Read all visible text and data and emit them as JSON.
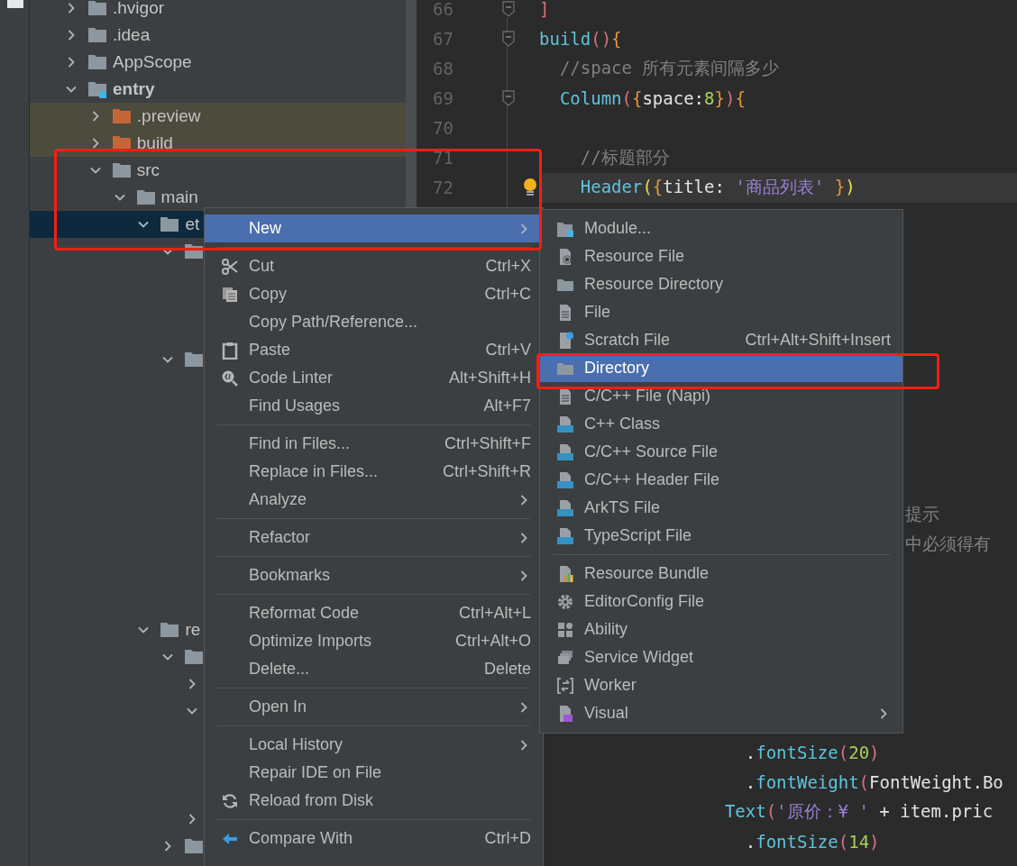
{
  "tree": [
    {
      "label": ".hvigor",
      "kind": "folder",
      "expanded": false,
      "selected": false,
      "excluded": false
    },
    {
      "label": ".idea",
      "kind": "folder",
      "expanded": false,
      "selected": false,
      "excluded": false
    },
    {
      "label": "AppScope",
      "kind": "folder",
      "expanded": false,
      "selected": false,
      "excluded": false
    },
    {
      "label": "entry",
      "kind": "module",
      "expanded": true,
      "selected": false,
      "excluded": false,
      "children": [
        {
          "label": ".preview",
          "kind": "folder",
          "expanded": false,
          "selected": false,
          "excluded": true
        },
        {
          "label": "build",
          "kind": "folder",
          "expanded": false,
          "selected": false,
          "excluded": true
        },
        {
          "label": "src",
          "kind": "folder",
          "expanded": true,
          "selected": false,
          "excluded": false,
          "children": [
            {
              "label": "main",
              "kind": "folder",
              "expanded": true,
              "selected": false,
              "excluded": false,
              "children": [
                {
                  "label": "et",
                  "kind": "folder",
                  "expanded": true,
                  "selected": true,
                  "excluded": false,
                  "children": [
                    {
                      "kind": "folder",
                      "expanded": true,
                      "selected": false,
                      "excluded": false
                    },
                    {
                      "kind": "folder",
                      "expanded": true,
                      "selected": false,
                      "excluded": false
                    }
                  ]
                },
                {
                  "label": "re",
                  "kind": "folder",
                  "expanded": true,
                  "selected": false,
                  "excluded": false,
                  "children": [
                    {
                      "kind": "folder",
                      "expanded": true,
                      "selected": false,
                      "excluded": false,
                      "children": [
                        {
                          "expanded": false,
                          "selected": false,
                          "excluded": false
                        },
                        {
                          "expanded": true,
                          "selected": false,
                          "excluded": false
                        },
                        {
                          "expanded": false,
                          "selected": false,
                          "excluded": false
                        }
                      ]
                    },
                    {
                      "kind": "folder",
                      "expanded": false,
                      "selected": false,
                      "excluded": false
                    }
                  ]
                }
              ]
            }
          ]
        }
      ]
    }
  ],
  "editor": {
    "lines": [
      {
        "number": "66",
        "fold": true,
        "current": false,
        "bulb": false,
        "tokens": [
          {
            "text": "]",
            "kind": "paren"
          }
        ]
      },
      {
        "number": "67",
        "fold": true,
        "current": false,
        "bulb": false,
        "tokens": [
          {
            "text": "build",
            "kind": "func"
          },
          {
            "text": "()",
            "kind": "paren"
          },
          {
            "text": "{",
            "kind": "brace"
          }
        ]
      },
      {
        "number": "68",
        "fold": false,
        "current": false,
        "bulb": false,
        "tokens": [
          {
            "text": "//space 所有元素间隔多少",
            "kind": "comment"
          }
        ]
      },
      {
        "number": "69",
        "fold": true,
        "current": false,
        "bulb": false,
        "tokens": [
          {
            "text": "Column",
            "kind": "func"
          },
          {
            "text": "(",
            "kind": "paren"
          },
          {
            "text": "{",
            "kind": "brace"
          },
          {
            "text": "space:",
            "kind": "plain"
          },
          {
            "text": "8",
            "kind": "number"
          },
          {
            "text": "}",
            "kind": "brace"
          },
          {
            "text": ")",
            "kind": "paren"
          },
          {
            "text": "{",
            "kind": "brace"
          }
        ]
      },
      {
        "number": "70",
        "fold": false,
        "current": false,
        "bulb": false
      },
      {
        "number": "71",
        "fold": false,
        "current": false,
        "bulb": false,
        "tokens": [
          {
            "text": "//标题部分",
            "kind": "comment"
          }
        ]
      },
      {
        "number": "72",
        "fold": false,
        "current": true,
        "bulb": true,
        "tokens": [
          {
            "text": "Header",
            "kind": "func"
          },
          {
            "text": "(",
            "kind": "match"
          },
          {
            "text": "{",
            "kind": "brace"
          },
          {
            "text": "title: ",
            "kind": "plain"
          },
          {
            "text": "'商品列表'",
            "kind": "string"
          },
          {
            "text": " }",
            "kind": "brace"
          },
          {
            "text": ")",
            "kind": "match"
          }
        ]
      },
      {
        "fold": false,
        "current": false,
        "bulb": false,
        "tokens": [
          {
            "text": "提示",
            "kind": "comment"
          }
        ]
      },
      {
        "fold": false,
        "current": false,
        "bulb": false,
        "tokens": [
          {
            "text": "中必须得有",
            "kind": "comment"
          }
        ]
      },
      {
        "fold": false,
        "current": false,
        "bulb": false,
        "tokens": [
          {
            "text": ".",
            "kind": "plain"
          },
          {
            "text": "fontSize",
            "kind": "func"
          },
          {
            "text": "(",
            "kind": "paren"
          },
          {
            "text": "20",
            "kind": "number"
          },
          {
            "text": ")",
            "kind": "paren"
          }
        ]
      },
      {
        "fold": false,
        "current": false,
        "bulb": false,
        "tokens": [
          {
            "text": ".",
            "kind": "plain"
          },
          {
            "text": "fontWeight",
            "kind": "func"
          },
          {
            "text": "(",
            "kind": "paren"
          },
          {
            "text": "FontWeight.Bo",
            "kind": "plain"
          }
        ]
      },
      {
        "fold": false,
        "current": false,
        "bulb": false,
        "tokens": [
          {
            "text": "Text",
            "kind": "func"
          },
          {
            "text": "(",
            "kind": "paren"
          },
          {
            "text": "'原价：¥ '",
            "kind": "string"
          },
          {
            "text": " + item.pric",
            "kind": "plain"
          }
        ]
      },
      {
        "fold": false,
        "current": false,
        "bulb": false,
        "tokens": [
          {
            "text": ".",
            "kind": "plain"
          },
          {
            "text": "fontSize",
            "kind": "func"
          },
          {
            "text": "(",
            "kind": "paren"
          },
          {
            "text": "14",
            "kind": "number"
          },
          {
            "text": ")",
            "kind": "paren"
          }
        ]
      }
    ]
  },
  "context_menu": {
    "items": [
      {
        "kind": "item",
        "label": "New",
        "selected": true,
        "submenu": true
      },
      {
        "kind": "separator"
      },
      {
        "kind": "item",
        "label": "Cut",
        "shortcut": "Ctrl+X",
        "selected": false,
        "submenu": false
      },
      {
        "kind": "item",
        "label": "Copy",
        "shortcut": "Ctrl+C",
        "selected": false,
        "submenu": false
      },
      {
        "kind": "item",
        "label": "Copy Path/Reference...",
        "selected": false,
        "submenu": false
      },
      {
        "kind": "item",
        "label": "Paste",
        "shortcut": "Ctrl+V",
        "selected": false,
        "submenu": false
      },
      {
        "kind": "item",
        "label": "Code Linter",
        "shortcut": "Alt+Shift+H",
        "selected": false,
        "submenu": false
      },
      {
        "kind": "item",
        "label": "Find Usages",
        "shortcut": "Alt+F7",
        "selected": false,
        "submenu": false
      },
      {
        "kind": "separator"
      },
      {
        "kind": "item",
        "label": "Find in Files...",
        "shortcut": "Ctrl+Shift+F",
        "selected": false,
        "submenu": false
      },
      {
        "kind": "item",
        "label": "Replace in Files...",
        "shortcut": "Ctrl+Shift+R",
        "selected": false,
        "submenu": false
      },
      {
        "kind": "item",
        "label": "Analyze",
        "selected": false,
        "submenu": true
      },
      {
        "kind": "separator"
      },
      {
        "kind": "item",
        "label": "Refactor",
        "selected": false,
        "submenu": true
      },
      {
        "kind": "separator"
      },
      {
        "kind": "item",
        "label": "Bookmarks",
        "selected": false,
        "submenu": true
      },
      {
        "kind": "separator"
      },
      {
        "kind": "item",
        "label": "Reformat Code",
        "shortcut": "Ctrl+Alt+L",
        "selected": false,
        "submenu": false
      },
      {
        "kind": "item",
        "label": "Optimize Imports",
        "shortcut": "Ctrl+Alt+O",
        "selected": false,
        "submenu": false
      },
      {
        "kind": "item",
        "label": "Delete...",
        "shortcut": "Delete",
        "selected": false,
        "submenu": false
      },
      {
        "kind": "separator"
      },
      {
        "kind": "item",
        "label": "Open In",
        "selected": false,
        "submenu": true
      },
      {
        "kind": "separator"
      },
      {
        "kind": "item",
        "label": "Local History",
        "selected": false,
        "submenu": true
      },
      {
        "kind": "item",
        "label": "Repair IDE on File",
        "selected": false,
        "submenu": false
      },
      {
        "kind": "item",
        "label": "Reload from Disk",
        "selected": false,
        "submenu": false
      },
      {
        "kind": "separator"
      },
      {
        "kind": "item",
        "label": "Compare With",
        "shortcut": "Ctrl+D",
        "selected": false,
        "submenu": false
      }
    ]
  },
  "new_submenu": {
    "items": [
      {
        "kind": "item",
        "label": "Module...",
        "selected": false,
        "submenu": false
      },
      {
        "kind": "item",
        "label": "Resource File",
        "selected": false,
        "submenu": false
      },
      {
        "kind": "item",
        "label": "Resource Directory",
        "selected": false,
        "submenu": false
      },
      {
        "kind": "item",
        "label": "File",
        "selected": false,
        "submenu": false
      },
      {
        "kind": "item",
        "label": "Scratch File",
        "shortcut": "Ctrl+Alt+Shift+Insert",
        "selected": false,
        "submenu": false
      },
      {
        "kind": "item",
        "label": "Directory",
        "selected": true,
        "submenu": false
      },
      {
        "kind": "item",
        "label": "C/C++ File (Napi)",
        "selected": false,
        "submenu": false
      },
      {
        "kind": "item",
        "label": "C++ Class",
        "selected": false,
        "submenu": false
      },
      {
        "kind": "item",
        "label": "C/C++ Source File",
        "selected": false,
        "submenu": false
      },
      {
        "kind": "item",
        "label": "C/C++ Header File",
        "selected": false,
        "submenu": false
      },
      {
        "kind": "item",
        "label": "ArkTS File",
        "selected": false,
        "submenu": false
      },
      {
        "kind": "item",
        "label": "TypeScript File",
        "selected": false,
        "submenu": false
      },
      {
        "kind": "separator"
      },
      {
        "kind": "item",
        "label": "Resource Bundle",
        "selected": false,
        "submenu": false
      },
      {
        "kind": "item",
        "label": "EditorConfig File",
        "selected": false,
        "submenu": false
      },
      {
        "kind": "item",
        "label": "Ability",
        "selected": false,
        "submenu": false
      },
      {
        "kind": "item",
        "label": "Service Widget",
        "selected": false,
        "submenu": false
      },
      {
        "kind": "item",
        "label": "Worker",
        "selected": false,
        "submenu": false
      },
      {
        "kind": "item",
        "label": "Visual",
        "selected": false,
        "submenu": true
      }
    ]
  }
}
